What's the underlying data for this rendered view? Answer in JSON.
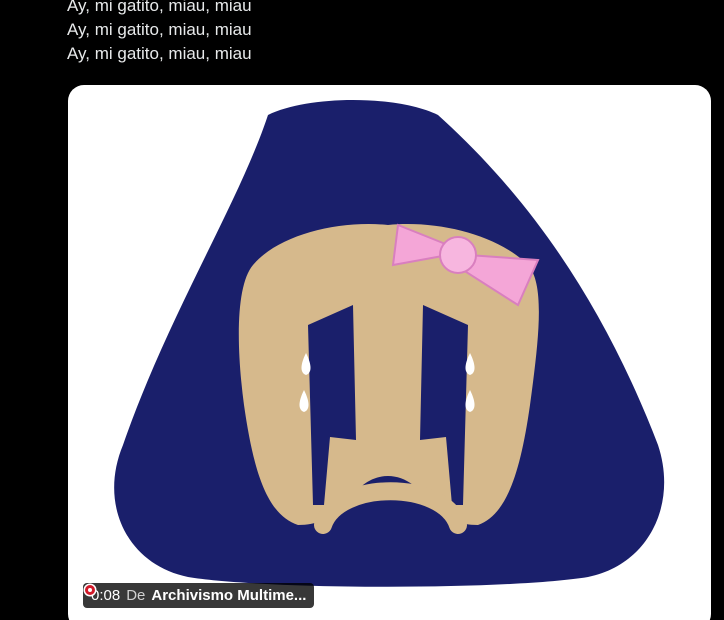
{
  "tweet": {
    "lines": [
      "Ay, mi gatito, miau, miau",
      "Ay, mi gatito, miau, miau",
      "Ay, mi gatito, miau, miau"
    ]
  },
  "media": {
    "image_subject": "sad-pumas-logo-with-pink-bow-icon",
    "colors": {
      "card_background": "#ffffff",
      "badge_navy": "#1a1f6b",
      "face_gold": "#d6b98c",
      "bow_pink": "#f4a6d7",
      "tear_white": "#ffffff"
    }
  },
  "video_overlay": {
    "duration": "0:08",
    "from_label": "De",
    "source_icon": "archivismo-avatar-icon",
    "source_name": "Archivismo Multime..."
  }
}
